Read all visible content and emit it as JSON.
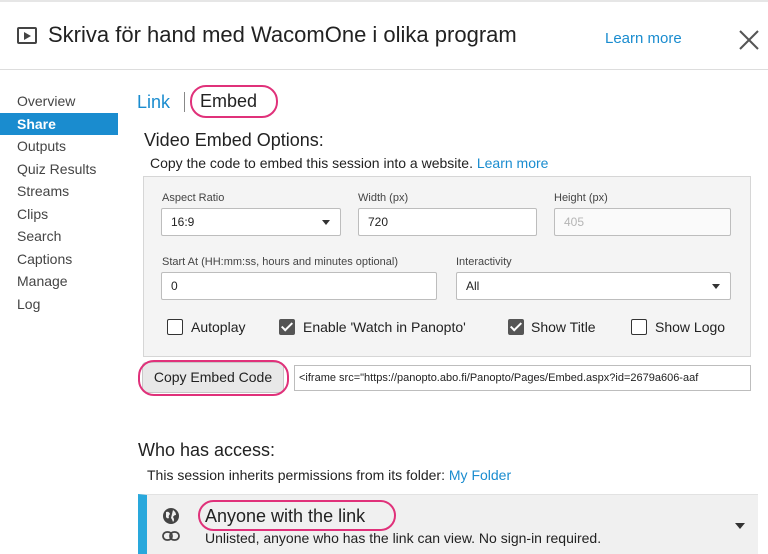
{
  "header": {
    "title": "Skriva för hand med WacomOne i olika program",
    "learn_more": "Learn more"
  },
  "sidebar": {
    "items": [
      {
        "label": "Overview"
      },
      {
        "label": "Share"
      },
      {
        "label": "Outputs"
      },
      {
        "label": "Quiz Results"
      },
      {
        "label": "Streams"
      },
      {
        "label": "Clips"
      },
      {
        "label": "Search"
      },
      {
        "label": "Captions"
      },
      {
        "label": "Manage"
      },
      {
        "label": "Log"
      }
    ],
    "active": "Share"
  },
  "tabs": {
    "link": "Link",
    "embed": "Embed"
  },
  "embed": {
    "title": "Video Embed Options:",
    "description": "Copy the code to embed this session into a website.",
    "learn_more": "Learn more",
    "aspect_ratio": {
      "label": "Aspect Ratio",
      "value": "16:9"
    },
    "width": {
      "label": "Width (px)",
      "value": "720"
    },
    "height": {
      "label": "Height (px)",
      "placeholder": "405"
    },
    "start_at": {
      "label": "Start At (HH:mm:ss, hours and minutes optional)",
      "value": "0"
    },
    "interactivity": {
      "label": "Interactivity",
      "value": "All"
    },
    "checkboxes": [
      {
        "label": "Autoplay",
        "checked": false
      },
      {
        "label": "Enable 'Watch in Panopto'",
        "checked": true
      },
      {
        "label": "Show Title",
        "checked": true
      },
      {
        "label": "Show Logo",
        "checked": false
      }
    ],
    "copy_button": "Copy Embed Code",
    "code": "<iframe src=\"https://panopto.abo.fi/Panopto/Pages/Embed.aspx?id=2679a606-aaf"
  },
  "access": {
    "title": "Who has access:",
    "description": "This session inherits permissions from its folder:",
    "folder_link": "My Folder",
    "level_title": "Anyone with the link",
    "level_description": "Unlisted, anyone who has the link can view. No sign-in required."
  },
  "colors": {
    "accent": "#1a8ccf",
    "highlight": "#e0317a",
    "access_bar": "#29a8dc"
  }
}
